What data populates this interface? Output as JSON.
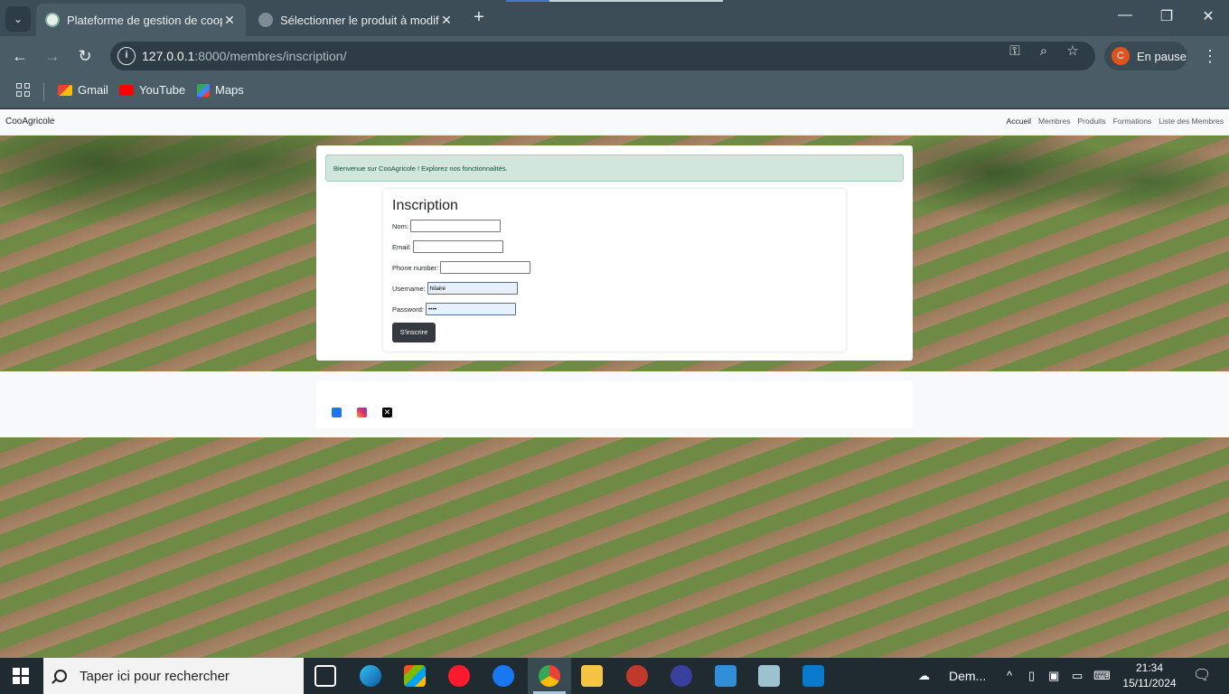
{
  "browser": {
    "tabs": [
      {
        "title": "Plateforme de gestion de coopé",
        "active": true
      },
      {
        "title": "Sélectionner le produit à modifi",
        "active": false
      }
    ],
    "url_host": "127.0.0.1",
    "url_path": ":8000/membres/inscription/",
    "profile_initial": "C",
    "profile_label": "En pause",
    "bookmarks": [
      {
        "label": "Gmail",
        "icon": "gmail-icon"
      },
      {
        "label": "YouTube",
        "icon": "youtube-icon"
      },
      {
        "label": "Maps",
        "icon": "maps-icon"
      }
    ]
  },
  "site": {
    "brand": "CooAgricole",
    "nav": [
      "Accueil",
      "Membres",
      "Produits",
      "Formations",
      "Liste des Membres"
    ],
    "alert": "Bienvenue sur CooAgricole ! Explorez nos fonctionnalités.",
    "form": {
      "title": "Inscription",
      "fields": [
        {
          "label": "Nom:",
          "value": ""
        },
        {
          "label": "Email:",
          "value": ""
        },
        {
          "label": "Phone number:",
          "value": ""
        },
        {
          "label": "Username:",
          "value": "hilaire"
        },
        {
          "label": "Password:",
          "value": "••••"
        }
      ],
      "submit": "S'inscrire"
    },
    "social": [
      "facebook-icon",
      "instagram-icon",
      "x-icon"
    ]
  },
  "taskbar": {
    "search_placeholder": "Taper ici pour rechercher",
    "weather": "Dem...",
    "time": "21:34",
    "date": "15/11/2024"
  },
  "colors": {
    "chrome_bg": "#3c4d57",
    "alert_bg": "#d1e7dd",
    "submit_bg": "#343a40"
  }
}
